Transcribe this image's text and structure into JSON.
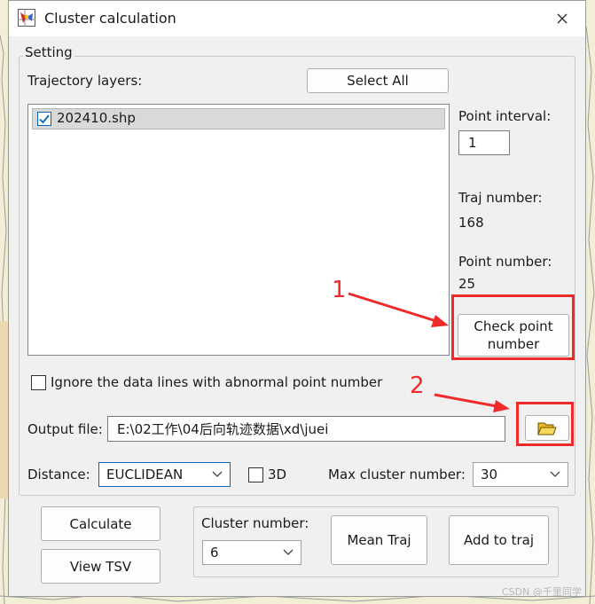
{
  "window": {
    "title": "Cluster calculation",
    "close_glyph": "✕"
  },
  "setting": {
    "group_label": "Setting",
    "trajectory_label": "Trajectory layers:",
    "select_all_label": "Select All",
    "layers": [
      {
        "name": "202410.shp",
        "checked": true
      }
    ],
    "point_interval_label": "Point interval:",
    "point_interval_value": "1",
    "traj_number_label": "Traj number:",
    "traj_number_value": "168",
    "point_number_label": "Point number:",
    "point_number_value": "25",
    "check_point_label": "Check point number",
    "ignore_label": "Ignore the data lines with abnormal point number",
    "ignore_checked": false,
    "output_label": "Output file:",
    "output_value": "E:\\02工作\\04后向轨迹数据\\xd\\juei",
    "distance_label": "Distance:",
    "distance_value": "EUCLIDEAN",
    "three_d_label": "3D",
    "three_d_checked": false,
    "max_cluster_label": "Max cluster number:",
    "max_cluster_value": "30"
  },
  "bottom": {
    "calculate_label": "Calculate",
    "view_tsv_label": "View TSV",
    "cluster_number_label": "Cluster number:",
    "cluster_number_value": "6",
    "mean_traj_label": "Mean Traj",
    "add_to_traj_label": "Add to traj"
  },
  "annotations": {
    "marker_1": "1",
    "marker_2": "2",
    "color": "#f02a2a"
  },
  "watermark": "CSDN @千里同学",
  "icons": [
    "app-icon",
    "close-icon",
    "folder-open-icon",
    "chevron-down-icon",
    "checkmark-icon"
  ]
}
